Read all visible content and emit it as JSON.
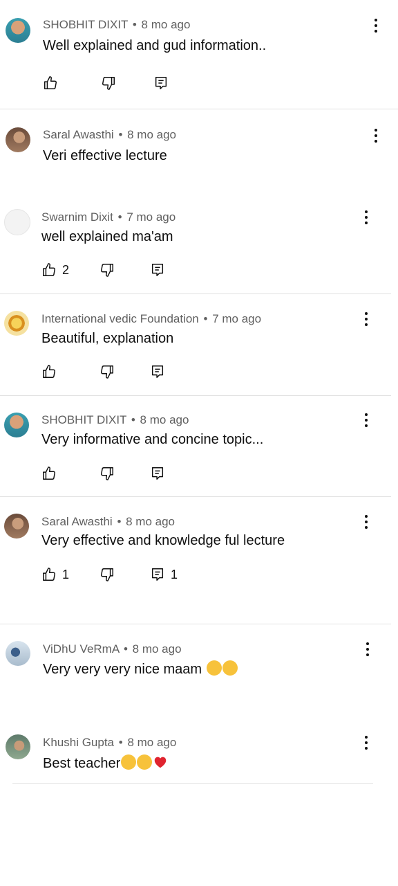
{
  "comments": [
    {
      "author": "SHOBHIT DIXIT",
      "age": "8 mo ago",
      "text": "Well explained and gud information..",
      "likes": "",
      "replies": ""
    },
    {
      "author": "Saral Awasthi",
      "age": "8 mo ago",
      "text": "Veri effective lecture",
      "likes": "",
      "replies": ""
    },
    {
      "author": "Swarnim Dixit",
      "age": "7 mo ago",
      "text": "well explained ma'am",
      "likes": "2",
      "replies": ""
    },
    {
      "author": "International vedic Foundation",
      "age": "7 mo ago",
      "text": "Beautiful, explanation",
      "likes": "",
      "replies": ""
    },
    {
      "author": "SHOBHIT DIXIT",
      "age": "8 mo ago",
      "text": "Very informative and concine topic...",
      "likes": "",
      "replies": ""
    },
    {
      "author": "Saral Awasthi",
      "age": "8 mo ago",
      "text": "Very effective and knowledge ful lecture",
      "likes": "1",
      "replies": "1"
    },
    {
      "author": "ViDhU VeRmA",
      "age": "8 mo ago",
      "text": "Very very very nice maam",
      "likes": "",
      "replies": ""
    },
    {
      "author": "Khushi Gupta",
      "age": "8 mo ago",
      "text": "Best teacher",
      "likes": "",
      "replies": ""
    }
  ],
  "separator": "•",
  "icons": {
    "like": "thumbs-up-icon",
    "dislike": "thumbs-down-icon",
    "reply": "reply-icon",
    "menu": "more-vert-icon"
  },
  "colors": {
    "text": "#0f0f0f",
    "meta": "#606060",
    "divider": "#e2e2e2"
  }
}
